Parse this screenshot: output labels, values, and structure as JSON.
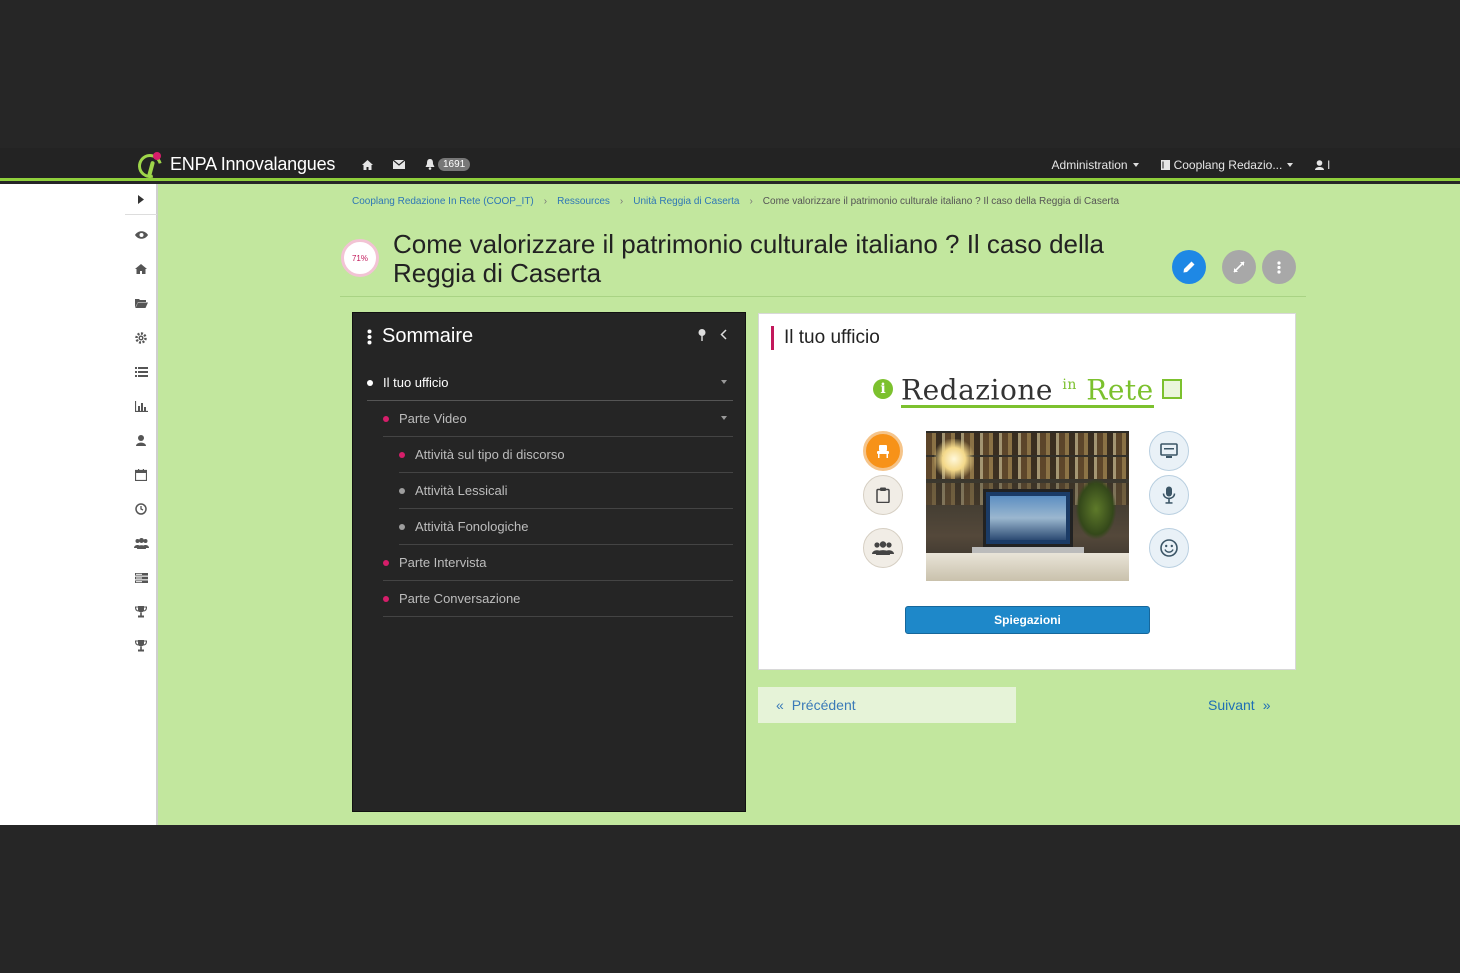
{
  "navbar": {
    "brand": "ENPA Innovalangues",
    "notification_count": "1691",
    "admin_label": "Administration",
    "workspace_label": "Cooplang Redazio...",
    "user_label": "l"
  },
  "breadcrumb": [
    "Cooplang Redazione In Rete (COOP_IT)",
    "Ressources",
    "Unità Reggia di Caserta",
    "Come valorizzare il patrimonio culturale italiano ? Il caso della Reggia di Caserta"
  ],
  "page": {
    "progress": "71%",
    "title": "Come valorizzare il patrimonio culturale italiano ? Il caso della Reggia di Caserta"
  },
  "toc": {
    "title": "Sommaire",
    "items": [
      {
        "label": "Il tuo ufficio",
        "level": 0,
        "bullet": "#ffffff",
        "active": true
      },
      {
        "label": "Parte Video",
        "level": 1,
        "bullet": "#d61e6a"
      },
      {
        "label": "Attività sul tipo di discorso",
        "level": 2,
        "bullet": "#d61e6a"
      },
      {
        "label": "Attività Lessicali",
        "level": 2,
        "bullet": "#9e9e9e"
      },
      {
        "label": "Attività Fonologiche",
        "level": 2,
        "bullet": "#9e9e9e"
      },
      {
        "label": "Parte Intervista",
        "level": 1,
        "bullet": "#d61e6a"
      },
      {
        "label": "Parte Conversazione",
        "level": 1,
        "bullet": "#d61e6a"
      }
    ]
  },
  "content": {
    "heading": "Il tuo ufficio",
    "logo_part1": "Redazione",
    "logo_in": "in",
    "logo_part2": "Rete",
    "button": "Spiegazioni"
  },
  "pager": {
    "prev": "Précédent",
    "next": "Suivant",
    "prev_arrow": "«",
    "next_arrow": "»"
  },
  "colors": {
    "accent_green": "#8fcf3c",
    "main_bg": "#c2e79e",
    "primary_blue": "#1e88e5",
    "magenta": "#d61e6a"
  }
}
